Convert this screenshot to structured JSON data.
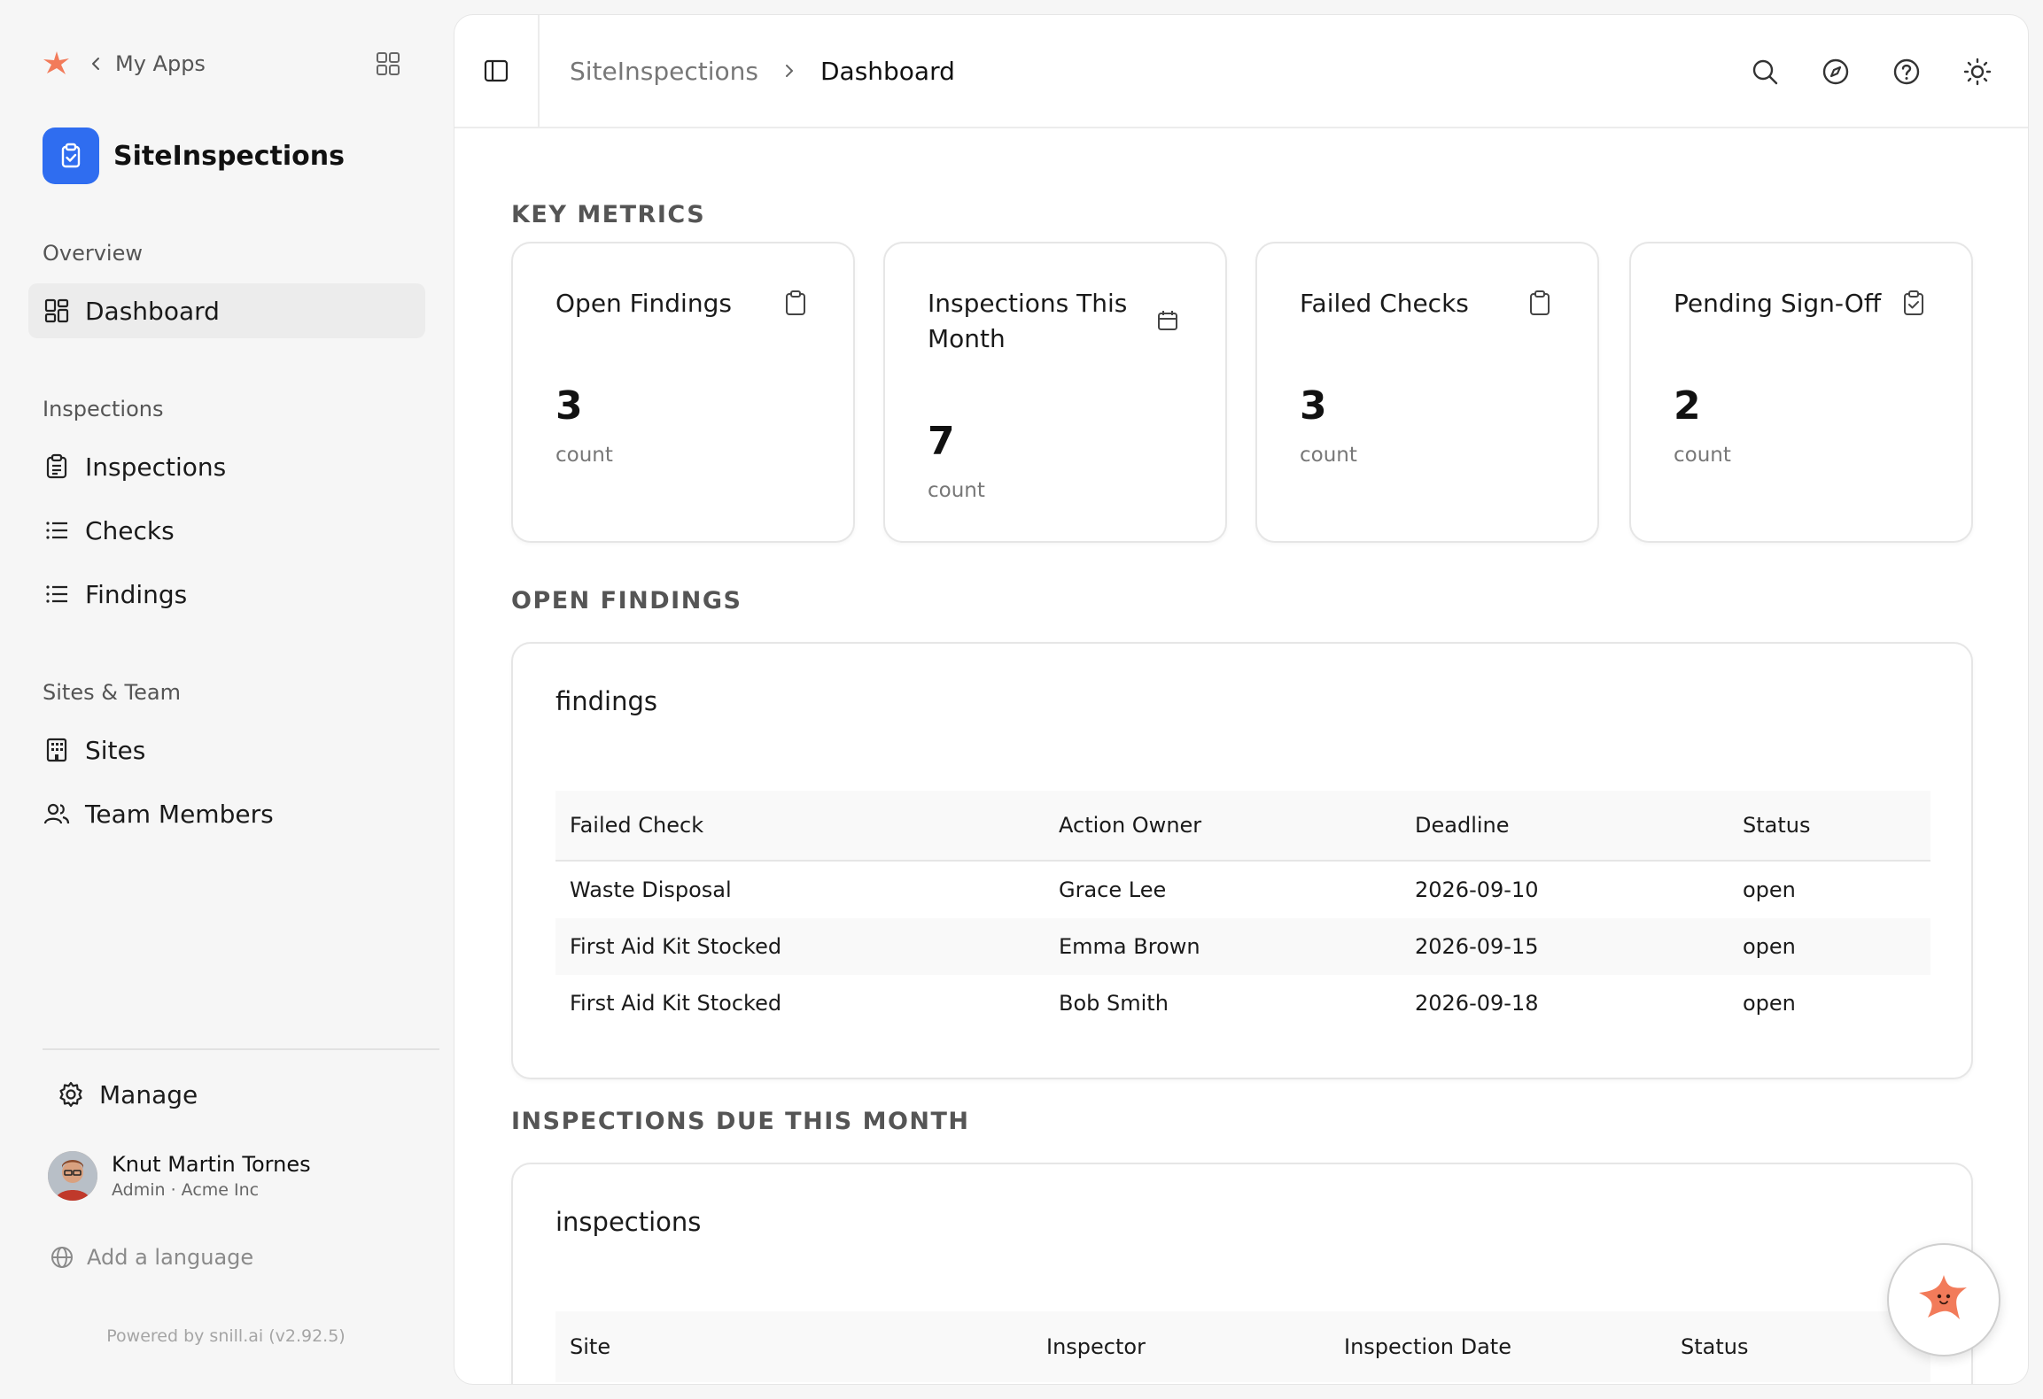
{
  "sidebar": {
    "my_apps": "My Apps",
    "app_name": "SiteInspections",
    "sections": {
      "overview": "Overview",
      "inspections": "Inspections",
      "sites_team": "Sites & Team"
    },
    "items": {
      "dashboard": "Dashboard",
      "inspections": "Inspections",
      "checks": "Checks",
      "findings": "Findings",
      "sites": "Sites",
      "team_members": "Team Members"
    },
    "manage": "Manage",
    "user": {
      "name": "Knut Martin Tornes",
      "role": "Admin · Acme Inc"
    },
    "add_language": "Add a language",
    "powered_by": "Powered by snill.ai (v2.92.5)"
  },
  "header": {
    "breadcrumb": [
      "SiteInspections",
      "Dashboard"
    ]
  },
  "sections": {
    "key_metrics": "KEY METRICS",
    "open_findings": "OPEN FINDINGS",
    "inspections_due": "INSPECTIONS DUE THIS MONTH"
  },
  "metrics": [
    {
      "title": "Open Findings",
      "value": "3",
      "unit": "count",
      "icon": "clipboard-icon"
    },
    {
      "title": "Inspections This Month",
      "value": "7",
      "unit": "count",
      "icon": "calendar-icon"
    },
    {
      "title": "Failed Checks",
      "value": "3",
      "unit": "count",
      "icon": "clipboard-icon"
    },
    {
      "title": "Pending Sign-Off",
      "value": "2",
      "unit": "count",
      "icon": "clipboard-check-icon"
    }
  ],
  "findings_table": {
    "title": "findings",
    "columns": [
      "Failed Check",
      "Action Owner",
      "Deadline",
      "Status"
    ],
    "rows": [
      [
        "Waste Disposal",
        "Grace Lee",
        "2026-09-10",
        "open"
      ],
      [
        "First Aid Kit Stocked",
        "Emma Brown",
        "2026-09-15",
        "open"
      ],
      [
        "First Aid Kit Stocked",
        "Bob Smith",
        "2026-09-18",
        "open"
      ]
    ]
  },
  "inspections_table": {
    "title": "inspections",
    "columns": [
      "Site",
      "Inspector",
      "Inspection Date",
      "Status"
    ]
  },
  "colors": {
    "accent": "#2f6df0",
    "brand_orange": "#f27b5a"
  }
}
